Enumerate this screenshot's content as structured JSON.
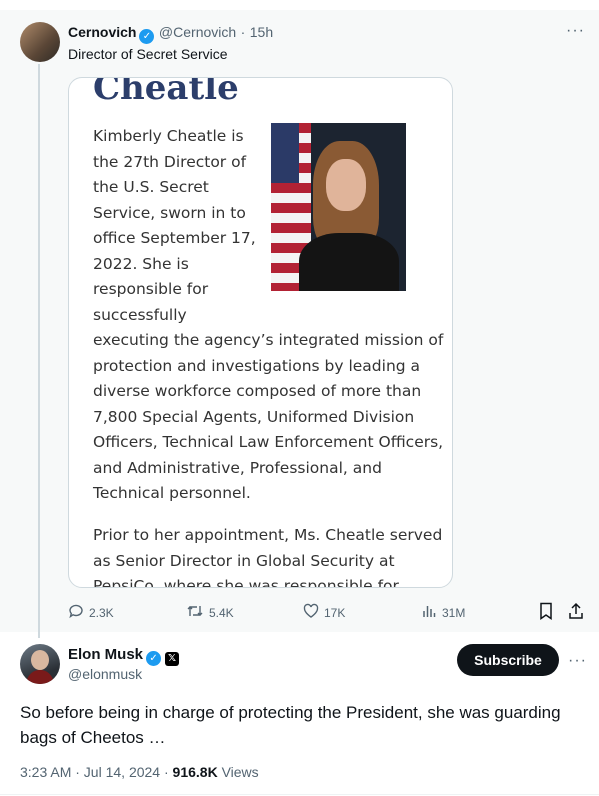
{
  "quoted_tweet": {
    "author_name": "Cernovich",
    "handle": "@Cernovich",
    "separator": "·",
    "time": "15h",
    "text": "Director of Secret Service",
    "more_icon": "ellipsis-icon",
    "card": {
      "title": "Cheatle",
      "intro_lines": [
        "Kimberly Cheatle is",
        "the 27th Director of",
        "the U.S. Secret",
        "Service, sworn in to",
        "office September 17,",
        "2022. She is",
        "responsible for",
        "successfully"
      ],
      "body_lines": [
        "executing the agency’s integrated mission of",
        "protection and investigations by leading a",
        "diverse workforce composed of more than",
        "7,800 Special Agents, Uniformed Division",
        "Officers, Technical Law Enforcement Officers,",
        "and Administrative, Professional, and",
        "Technical personnel."
      ],
      "para2_lines": [
        "Prior to her appointment, Ms. Cheatle served",
        "as Senior Director in Global Security at",
        "PepsiCo, where she was responsible for"
      ]
    },
    "actions": {
      "replies": "2.3K",
      "reposts": "5.4K",
      "likes": "17K",
      "views": "31M"
    }
  },
  "main_tweet": {
    "author_name": "Elon Musk",
    "handle": "@elonmusk",
    "subscribe_label": "Subscribe",
    "text": "So before being in charge of protecting the President, she was guarding bags of Cheetos …",
    "time": "3:23 AM · Jul 14, 2024 · ",
    "views_count": "916.8K",
    "views_label": " Views"
  },
  "colors": {
    "accent": "#1d9bf0",
    "muted": "#536471",
    "text": "#0f1419",
    "card_title": "#2c3e6b"
  }
}
